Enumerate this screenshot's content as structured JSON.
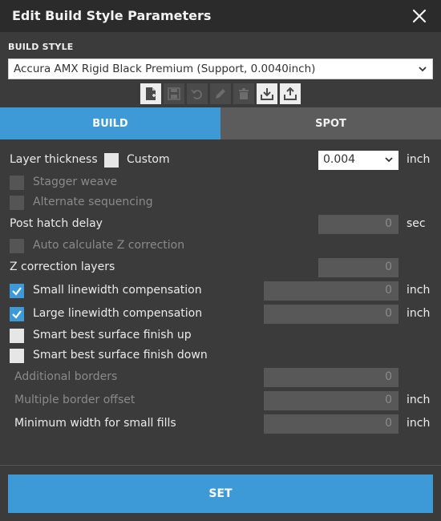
{
  "window": {
    "title": "Edit Build Style Parameters"
  },
  "build_style": {
    "label": "BUILD STYLE",
    "selected": "Accura AMX Rigid Black Premium (Support, 0.0040inch)"
  },
  "toolbar": {
    "icons": [
      "new-file-icon",
      "save-icon",
      "undo-icon",
      "edit-icon",
      "delete-icon",
      "import-icon",
      "export-icon"
    ]
  },
  "tabs": [
    {
      "label": "BUILD",
      "active": true
    },
    {
      "label": "SPOT",
      "active": false
    }
  ],
  "params": {
    "layer_thickness": {
      "label": "Layer thickness",
      "custom_label": "Custom",
      "value": "0.004",
      "unit": "inch"
    },
    "stagger_weave": {
      "label": "Stagger weave"
    },
    "alternate_sequencing": {
      "label": "Alternate sequencing"
    },
    "post_hatch_delay": {
      "label": "Post hatch delay",
      "value": "0",
      "unit": "sec"
    },
    "auto_calc_z": {
      "label": "Auto calculate Z correction"
    },
    "z_correction_layers": {
      "label": "Z correction layers",
      "value": "0"
    },
    "small_linewidth": {
      "label": "Small linewidth compensation",
      "checked": true,
      "value": "0",
      "unit": "inch"
    },
    "large_linewidth": {
      "label": "Large linewidth compensation",
      "checked": true,
      "value": "0",
      "unit": "inch"
    },
    "smart_up": {
      "label": "Smart best surface finish up",
      "checked": false
    },
    "smart_down": {
      "label": "Smart best surface finish down",
      "checked": false
    },
    "additional_borders": {
      "label": "Additional borders",
      "value": "0"
    },
    "multiple_border_offset": {
      "label": "Multiple border offset",
      "value": "0",
      "unit": "inch"
    },
    "min_width_small_fills": {
      "label": "Minimum width for small fills",
      "value": "0",
      "unit": "inch"
    }
  },
  "actions": {
    "set_label": "SET"
  },
  "colors": {
    "accent": "#3e9ad6",
    "background": "#3b3b3b",
    "titlebar": "#2b2b2b"
  }
}
